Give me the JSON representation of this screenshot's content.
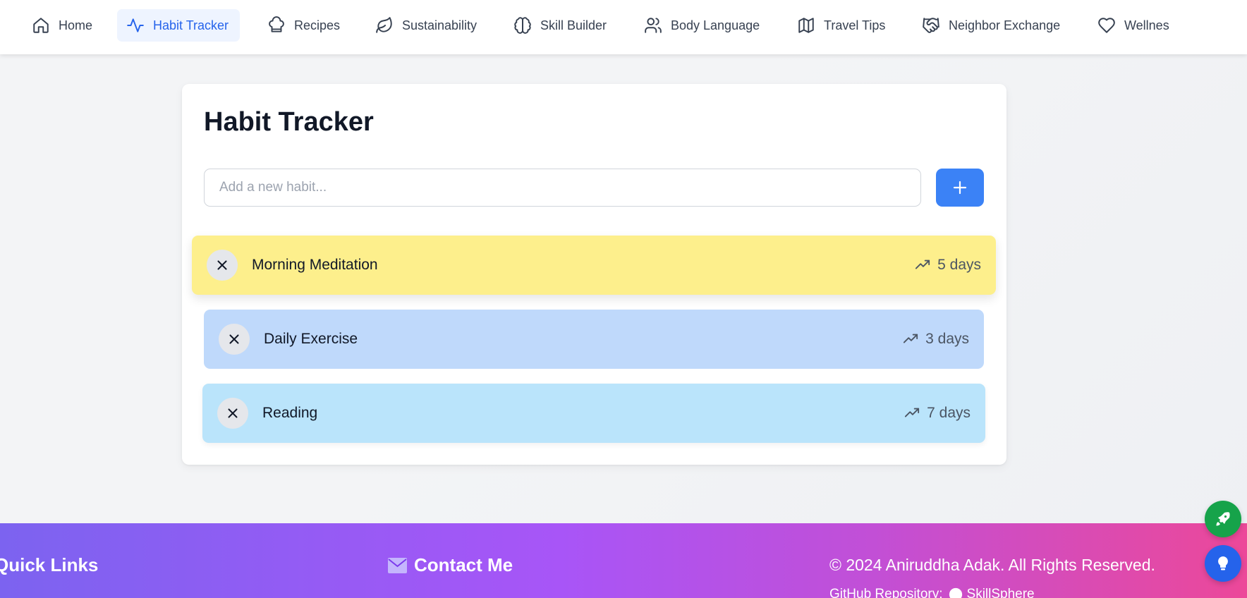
{
  "nav": {
    "items": [
      {
        "label": "Home",
        "icon": "home-icon"
      },
      {
        "label": "Habit Tracker",
        "icon": "activity-icon",
        "active": true
      },
      {
        "label": "Recipes",
        "icon": "chef-hat-icon"
      },
      {
        "label": "Sustainability",
        "icon": "leaf-icon"
      },
      {
        "label": "Skill Builder",
        "icon": "brain-icon"
      },
      {
        "label": "Body Language",
        "icon": "users-icon"
      },
      {
        "label": "Travel Tips",
        "icon": "map-icon"
      },
      {
        "label": "Neighbor Exchange",
        "icon": "handshake-icon"
      },
      {
        "label": "Wellness",
        "icon": "heart-icon"
      }
    ]
  },
  "main": {
    "title": "Habit Tracker",
    "input_placeholder": "Add a new habit...",
    "add_icon": "plus-icon",
    "habits": [
      {
        "name": "Morning Meditation",
        "streak": "5 days",
        "color": "#fdef8c"
      },
      {
        "name": "Daily Exercise",
        "streak": "3 days",
        "color": "#bfd9fb"
      },
      {
        "name": "Reading",
        "streak": "7 days",
        "color": "#bae4fb"
      }
    ]
  },
  "footer": {
    "quick_links": "Quick Links",
    "contact": "Contact Me",
    "copyright": "© 2024 Aniruddha Adak. All Rights Reserved.",
    "repo_label": "GitHub Repository:",
    "repo_name": "SkillSphere"
  },
  "colors": {
    "accent": "#3b82f6",
    "active_nav": "#2563eb",
    "fab_green": "#16a34a",
    "fab_blue": "#2563eb"
  }
}
